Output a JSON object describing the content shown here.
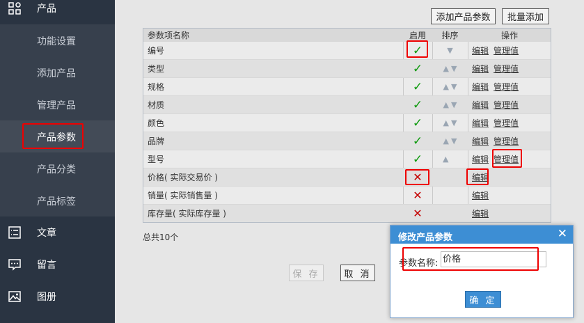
{
  "sidebar": {
    "section_product": "产品",
    "sub_items": [
      "功能设置",
      "添加产品",
      "管理产品",
      "产品参数",
      "产品分类",
      "产品标签"
    ],
    "section_article": "文章",
    "section_message": "留言",
    "section_album": "图册"
  },
  "toolbar": {
    "add_param": "添加产品参数",
    "batch_add": "批量添加"
  },
  "table": {
    "headers": {
      "name": "参数项名称",
      "enabled": "启用",
      "sort": "排序",
      "ops": "操作"
    },
    "edit_label": "编辑",
    "manage_label": "管理值",
    "rows": [
      {
        "name": "编号"
      },
      {
        "name": "类型"
      },
      {
        "name": "规格"
      },
      {
        "name": "材质"
      },
      {
        "name": "颜色"
      },
      {
        "name": "品牌"
      },
      {
        "name": "型号"
      },
      {
        "name": "价格( 实际交易价 )"
      },
      {
        "name": "销量( 实际销售量 )"
      },
      {
        "name": "库存量( 实际库存量 )"
      }
    ]
  },
  "footer": {
    "total": "总共10个",
    "save": "保 存",
    "cancel": "取 消"
  },
  "dialog": {
    "title": "修改产品参数",
    "label": "参数名称:",
    "input_value": "价格",
    "ok": "确 定"
  }
}
